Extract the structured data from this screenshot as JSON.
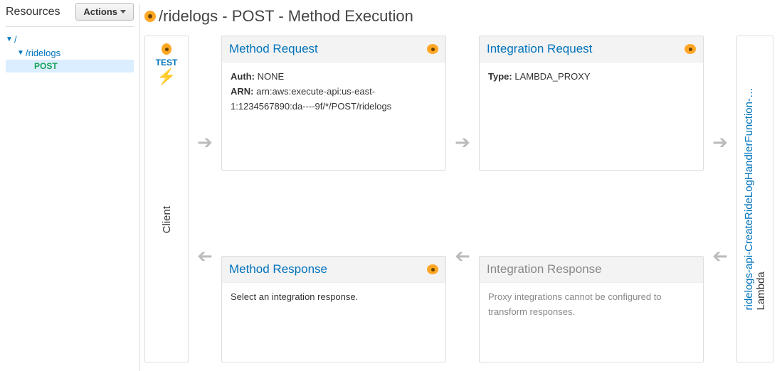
{
  "sidebar": {
    "title": "Resources",
    "actions_label": "Actions",
    "tree": {
      "root": "/",
      "resource": "/ridelogs",
      "method": "POST"
    }
  },
  "heading": "/ridelogs - POST - Method Execution",
  "client": {
    "test_label": "TEST",
    "label": "Client"
  },
  "lambda": {
    "prefix": "Lambda",
    "fn_name": "ridelogs-api-CreateRideLogHandlerFunction-…"
  },
  "cards": {
    "method_request": {
      "title": "Method Request",
      "auth_label": "Auth:",
      "auth_value": "NONE",
      "arn_label": "ARN:",
      "arn_value": "arn:aws:execute-api:us-east-1:1234567890:da----9f/*/POST/ridelogs"
    },
    "integration_request": {
      "title": "Integration Request",
      "type_label": "Type:",
      "type_value": "LAMBDA_PROXY"
    },
    "method_response": {
      "title": "Method Response",
      "body": "Select an integration response."
    },
    "integration_response": {
      "title": "Integration Response",
      "body": "Proxy integrations cannot be configured to transform responses."
    }
  }
}
